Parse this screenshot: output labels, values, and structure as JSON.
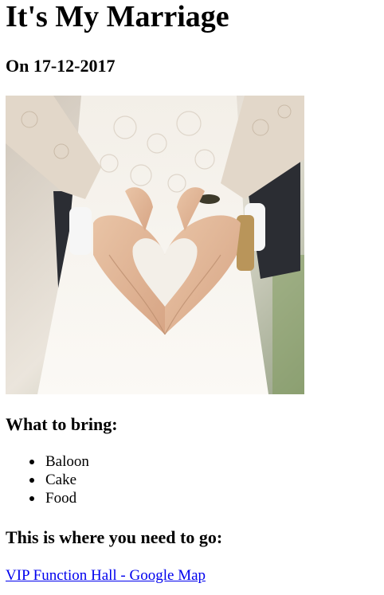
{
  "page": {
    "title": "It's My Marriage",
    "date_line": "On 17-12-2017"
  },
  "photo": {
    "subject": "bride and groom hands forming a heart shape"
  },
  "bring": {
    "heading": "What to bring:",
    "items": [
      "Baloon",
      "Cake",
      "Food"
    ]
  },
  "location": {
    "heading": "This is where you need to go:",
    "link_text": "VIP Function Hall - Google Map"
  },
  "colors": {
    "text": "#000000",
    "link": "#0000ee",
    "background": "#ffffff"
  }
}
